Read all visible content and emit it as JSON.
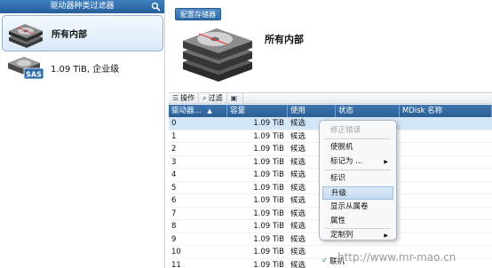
{
  "filter_panel": {
    "title": "驱动器种类过滤器",
    "search_icon": "search-icon",
    "items": [
      {
        "label": "所有内部",
        "icon": "hard-drive-icon",
        "selected": true
      },
      {
        "label": "1.09 TiB, 企业级",
        "icon": "sas-drive-icon",
        "badge": "SAS",
        "selected": false
      }
    ]
  },
  "config_button": "配置存储器",
  "main_title": "所有内部",
  "toolbar": {
    "actions_label": "操作",
    "filter_label": "过滤"
  },
  "grid": {
    "columns": [
      "驱动器...",
      "容量",
      "使用",
      "状态",
      "MDisk 名称"
    ],
    "rows": [
      {
        "id": "0",
        "capacity": "1.09 TiB",
        "use": "候选",
        "selected": true
      },
      {
        "id": "1",
        "capacity": "1.09 TiB",
        "use": "候选"
      },
      {
        "id": "2",
        "capacity": "1.09 TiB",
        "use": "候选"
      },
      {
        "id": "3",
        "capacity": "1.09 TiB",
        "use": "候选"
      },
      {
        "id": "4",
        "capacity": "1.09 TiB",
        "use": "候选"
      },
      {
        "id": "5",
        "capacity": "1.09 TiB",
        "use": "候选"
      },
      {
        "id": "6",
        "capacity": "1.09 TiB",
        "use": "候选"
      },
      {
        "id": "7",
        "capacity": "1.09 TiB",
        "use": "候选"
      },
      {
        "id": "8",
        "capacity": "1.09 TiB",
        "use": "候选"
      },
      {
        "id": "9",
        "capacity": "1.09 TiB",
        "use": "候选"
      },
      {
        "id": "10",
        "capacity": "1.09 TiB",
        "use": "候选"
      },
      {
        "id": "11",
        "capacity": "1.09 TiB",
        "use": "候选"
      }
    ]
  },
  "context_menu": {
    "items": [
      {
        "label": "修正错误",
        "disabled": true
      },
      {
        "label": "使脱机"
      },
      {
        "label": "标记为 ...",
        "submenu": true
      },
      {
        "label": "标识"
      },
      {
        "label": "升级",
        "highlighted": true
      },
      {
        "label": "显示从属卷"
      },
      {
        "label": "属性"
      },
      {
        "label": "定制列",
        "submenu": true
      }
    ]
  },
  "status_overlay": "联机",
  "watermark": "http://www.mr-mao.cn",
  "colors": {
    "header_blue": "#2b5e93",
    "selection_blue": "#d3e6f8"
  }
}
